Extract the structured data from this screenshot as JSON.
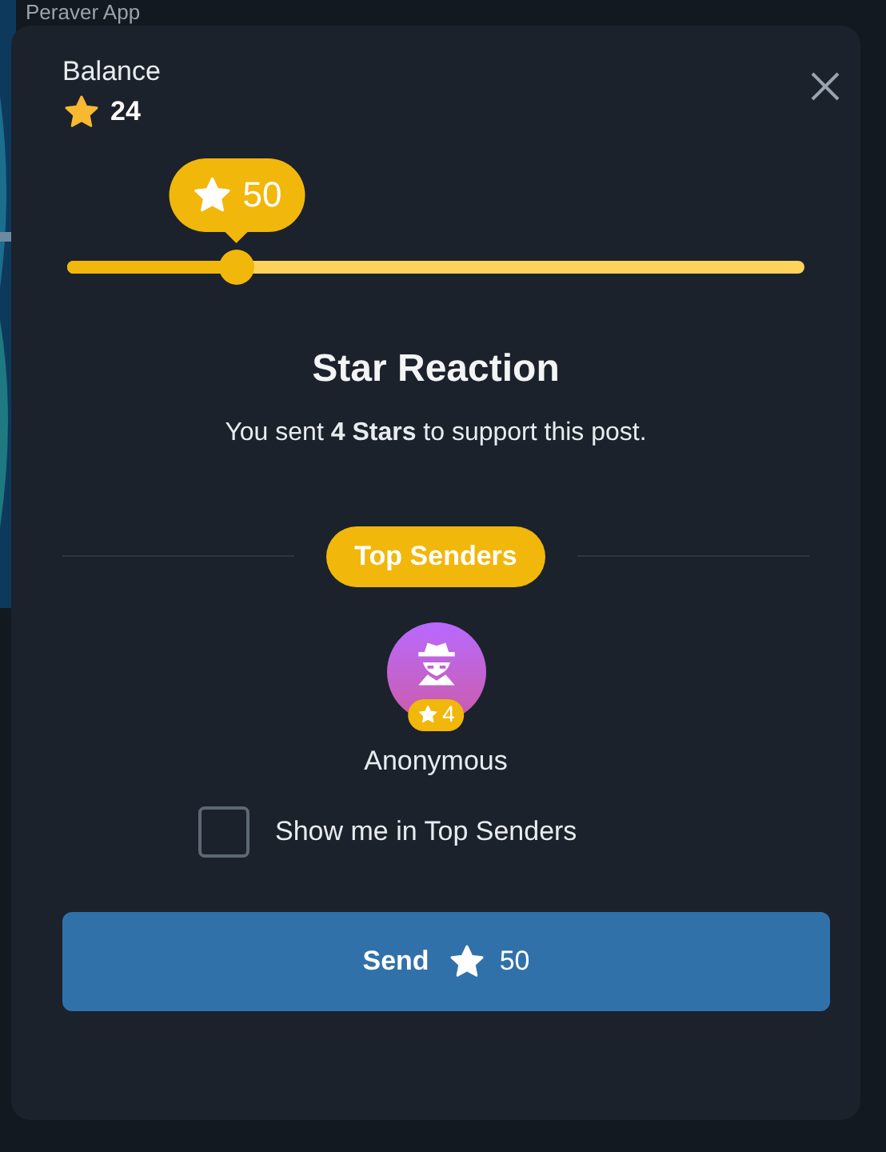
{
  "background": {
    "title": "Peraver App"
  },
  "balance": {
    "label": "Balance",
    "value": "24"
  },
  "slider": {
    "level": 0.23,
    "tooltip": "50"
  },
  "title": "Star Reaction",
  "description": "You sent **4 Stars** to support this post.",
  "top_senders": {
    "label": "Top Senders",
    "senders": [
      {
        "name": "Anonymous",
        "stars": "4"
      }
    ]
  },
  "show_me": {
    "label": "Show me in Top Senders",
    "checked": false
  },
  "send_button": {
    "label": "Send",
    "amount": "50"
  }
}
